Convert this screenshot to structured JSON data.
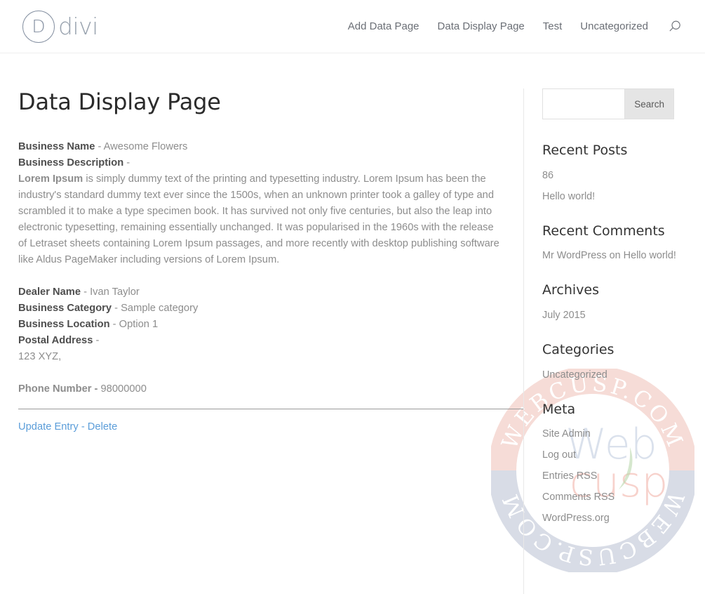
{
  "header": {
    "logo": {
      "mark": "D",
      "text": "divi",
      "name": "divi-logo"
    },
    "nav": [
      {
        "label": "Add Data Page"
      },
      {
        "label": "Data Display Page"
      },
      {
        "label": "Test"
      },
      {
        "label": "Uncategorized"
      }
    ],
    "search_icon": "search-icon"
  },
  "main": {
    "title": "Data Display Page",
    "fields": [
      {
        "label": "Business Name",
        "sep": " - ",
        "value": "Awesome Flowers"
      },
      {
        "label": "Business Description",
        "sep": " -",
        "value": ""
      }
    ],
    "lorem": {
      "lead": "Lorem Ipsum",
      "body": " is simply dummy text of the printing and typesetting industry. Lorem Ipsum has been the industry's standard dummy text ever since the 1500s, when an unknown printer took a galley of type and scrambled it to make a type specimen book. It has survived not only five centuries, but also the leap into electronic typesetting, remaining essentially unchanged. It was popularised in the 1960s with the release of Letraset sheets containing Lorem Ipsum passages, and more recently with desktop publishing software like Aldus PageMaker including versions of Lorem Ipsum."
    },
    "details": [
      {
        "label": "Dealer Name",
        "sep": " - ",
        "value": "Ivan Taylor"
      },
      {
        "label": "Business Category",
        "sep": " - ",
        "value": "Sample category"
      },
      {
        "label": "Business Location",
        "sep": " - ",
        "value": "Option 1"
      },
      {
        "label": "Postal Address",
        "sep": " -",
        "value": ""
      }
    ],
    "address": "123 XYZ,",
    "phone": {
      "label": "Phone Number -",
      "value": " 98000000"
    },
    "actions": {
      "update": "Update Entry",
      "separator": " - ",
      "delete": "Delete"
    }
  },
  "sidebar": {
    "search": {
      "value": "",
      "placeholder": "",
      "button": "Search"
    },
    "widgets": [
      {
        "title": "Recent Posts",
        "items": [
          "86",
          "Hello world!"
        ]
      },
      {
        "title": "Recent Comments",
        "items": [
          "Mr WordPress on Hello world!"
        ]
      },
      {
        "title": "Archives",
        "items": [
          "July 2015"
        ]
      },
      {
        "title": "Categories",
        "items": [
          "Uncategorized"
        ]
      },
      {
        "title": "Meta",
        "items": [
          "Site Admin",
          "Log out",
          "Entries RSS",
          "Comments RSS",
          "WordPress.org"
        ]
      }
    ]
  },
  "watermark": {
    "top_text": "WEBCUSP.COM",
    "bottom_text": "WEBCUSP.COM",
    "brand_top": "Web",
    "brand_bottom": "cusp",
    "ring_top_color": "#f6dcd7",
    "ring_bottom_color": "#d8dce6"
  },
  "colors": {
    "accent": "#2ea3f2",
    "link": "#5b9dd9",
    "heading": "#2b2b2b",
    "body_text": "#8d8d8d",
    "label_text": "#4e4e4e",
    "logo": "#98a2ae"
  }
}
